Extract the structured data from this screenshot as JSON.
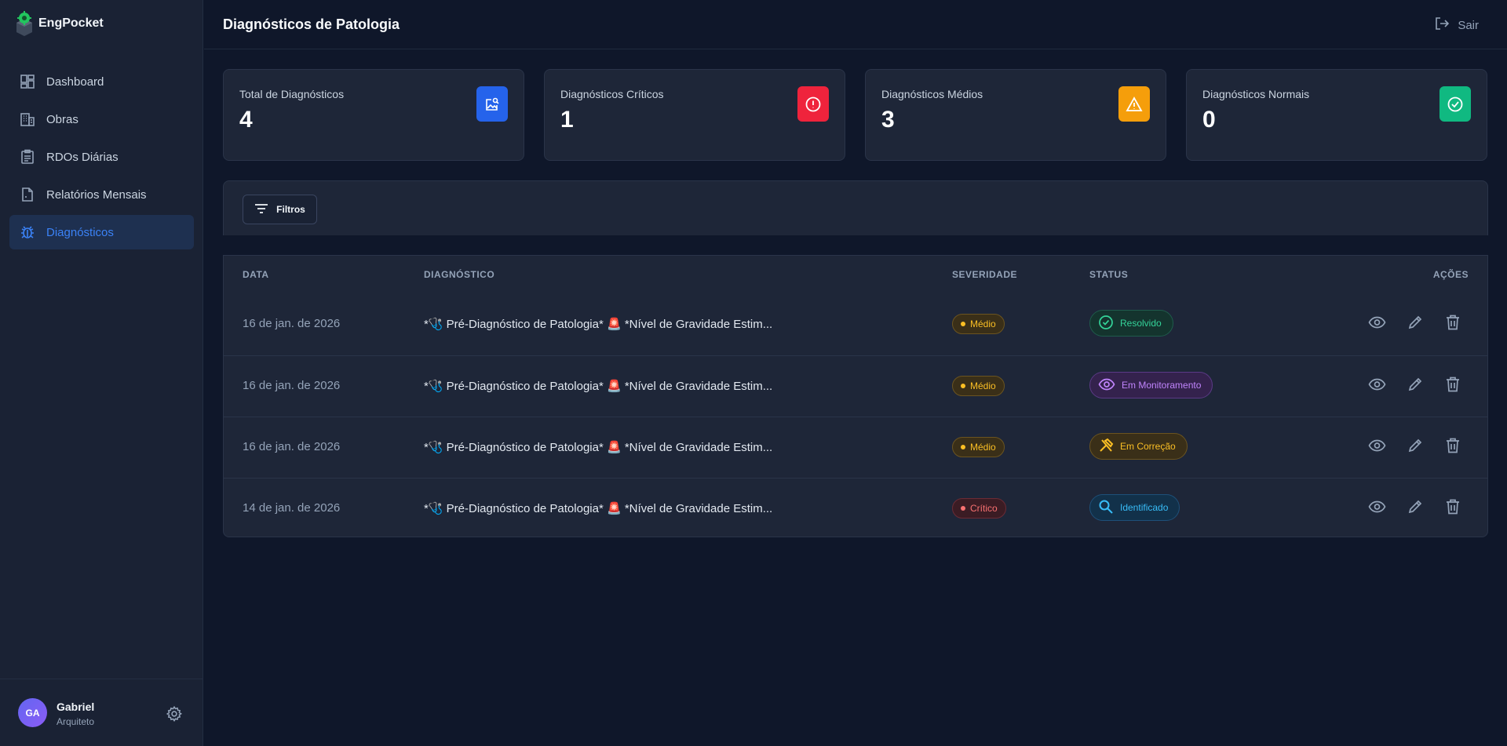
{
  "app": {
    "name": "EngPocket"
  },
  "sidebar": {
    "items": [
      {
        "label": "Dashboard",
        "icon": "dashboard-icon"
      },
      {
        "label": "Obras",
        "icon": "building-icon"
      },
      {
        "label": "RDOs Diárias",
        "icon": "clipboard-icon"
      },
      {
        "label": "Relatórios Mensais",
        "icon": "document-icon"
      },
      {
        "label": "Diagnósticos",
        "icon": "bug-icon",
        "active": true
      }
    ],
    "user": {
      "initials": "GA",
      "name": "Gabriel",
      "role": "Arquiteto"
    }
  },
  "header": {
    "title": "Diagnósticos de Patologia",
    "logout_label": "Sair"
  },
  "stats": [
    {
      "label": "Total de Diagnósticos",
      "value": "4",
      "color": "#2563eb",
      "icon": "image-search-icon"
    },
    {
      "label": "Diagnósticos Críticos",
      "value": "1",
      "color": "#ef233c",
      "icon": "alert-circle-icon"
    },
    {
      "label": "Diagnósticos Médios",
      "value": "3",
      "color": "#f59e0b",
      "icon": "warning-icon"
    },
    {
      "label": "Diagnósticos Normais",
      "value": "0",
      "color": "#10b981",
      "icon": "check-circle-icon"
    }
  ],
  "filters": {
    "label": "Filtros"
  },
  "table": {
    "headers": {
      "date": "DATA",
      "diagnosis": "DIAGNÓSTICO",
      "severity": "SEVERIDADE",
      "status": "STATUS",
      "actions": "AÇÕES"
    },
    "rows": [
      {
        "date": "16 de jan. de 2026",
        "diagnosis": "*🩺 Pré-Diagnóstico de Patologia* 🚨 *Nível de Gravidade Estim...",
        "severity": "Médio",
        "status": "Resolvido"
      },
      {
        "date": "16 de jan. de 2026",
        "diagnosis": "*🩺 Pré-Diagnóstico de Patologia* 🚨 *Nível de Gravidade Estim...",
        "severity": "Médio",
        "status": "Em Monitoramento"
      },
      {
        "date": "16 de jan. de 2026",
        "diagnosis": "*🩺 Pré-Diagnóstico de Patologia* 🚨 *Nível de Gravidade Estim...",
        "severity": "Médio",
        "status": "Em Correção"
      },
      {
        "date": "14 de jan. de 2026",
        "diagnosis": "*🩺 Pré-Diagnóstico de Patologia* 🚨 *Nível de Gravidade Estim...",
        "severity": "Crítico",
        "status": "Identificado"
      }
    ]
  }
}
